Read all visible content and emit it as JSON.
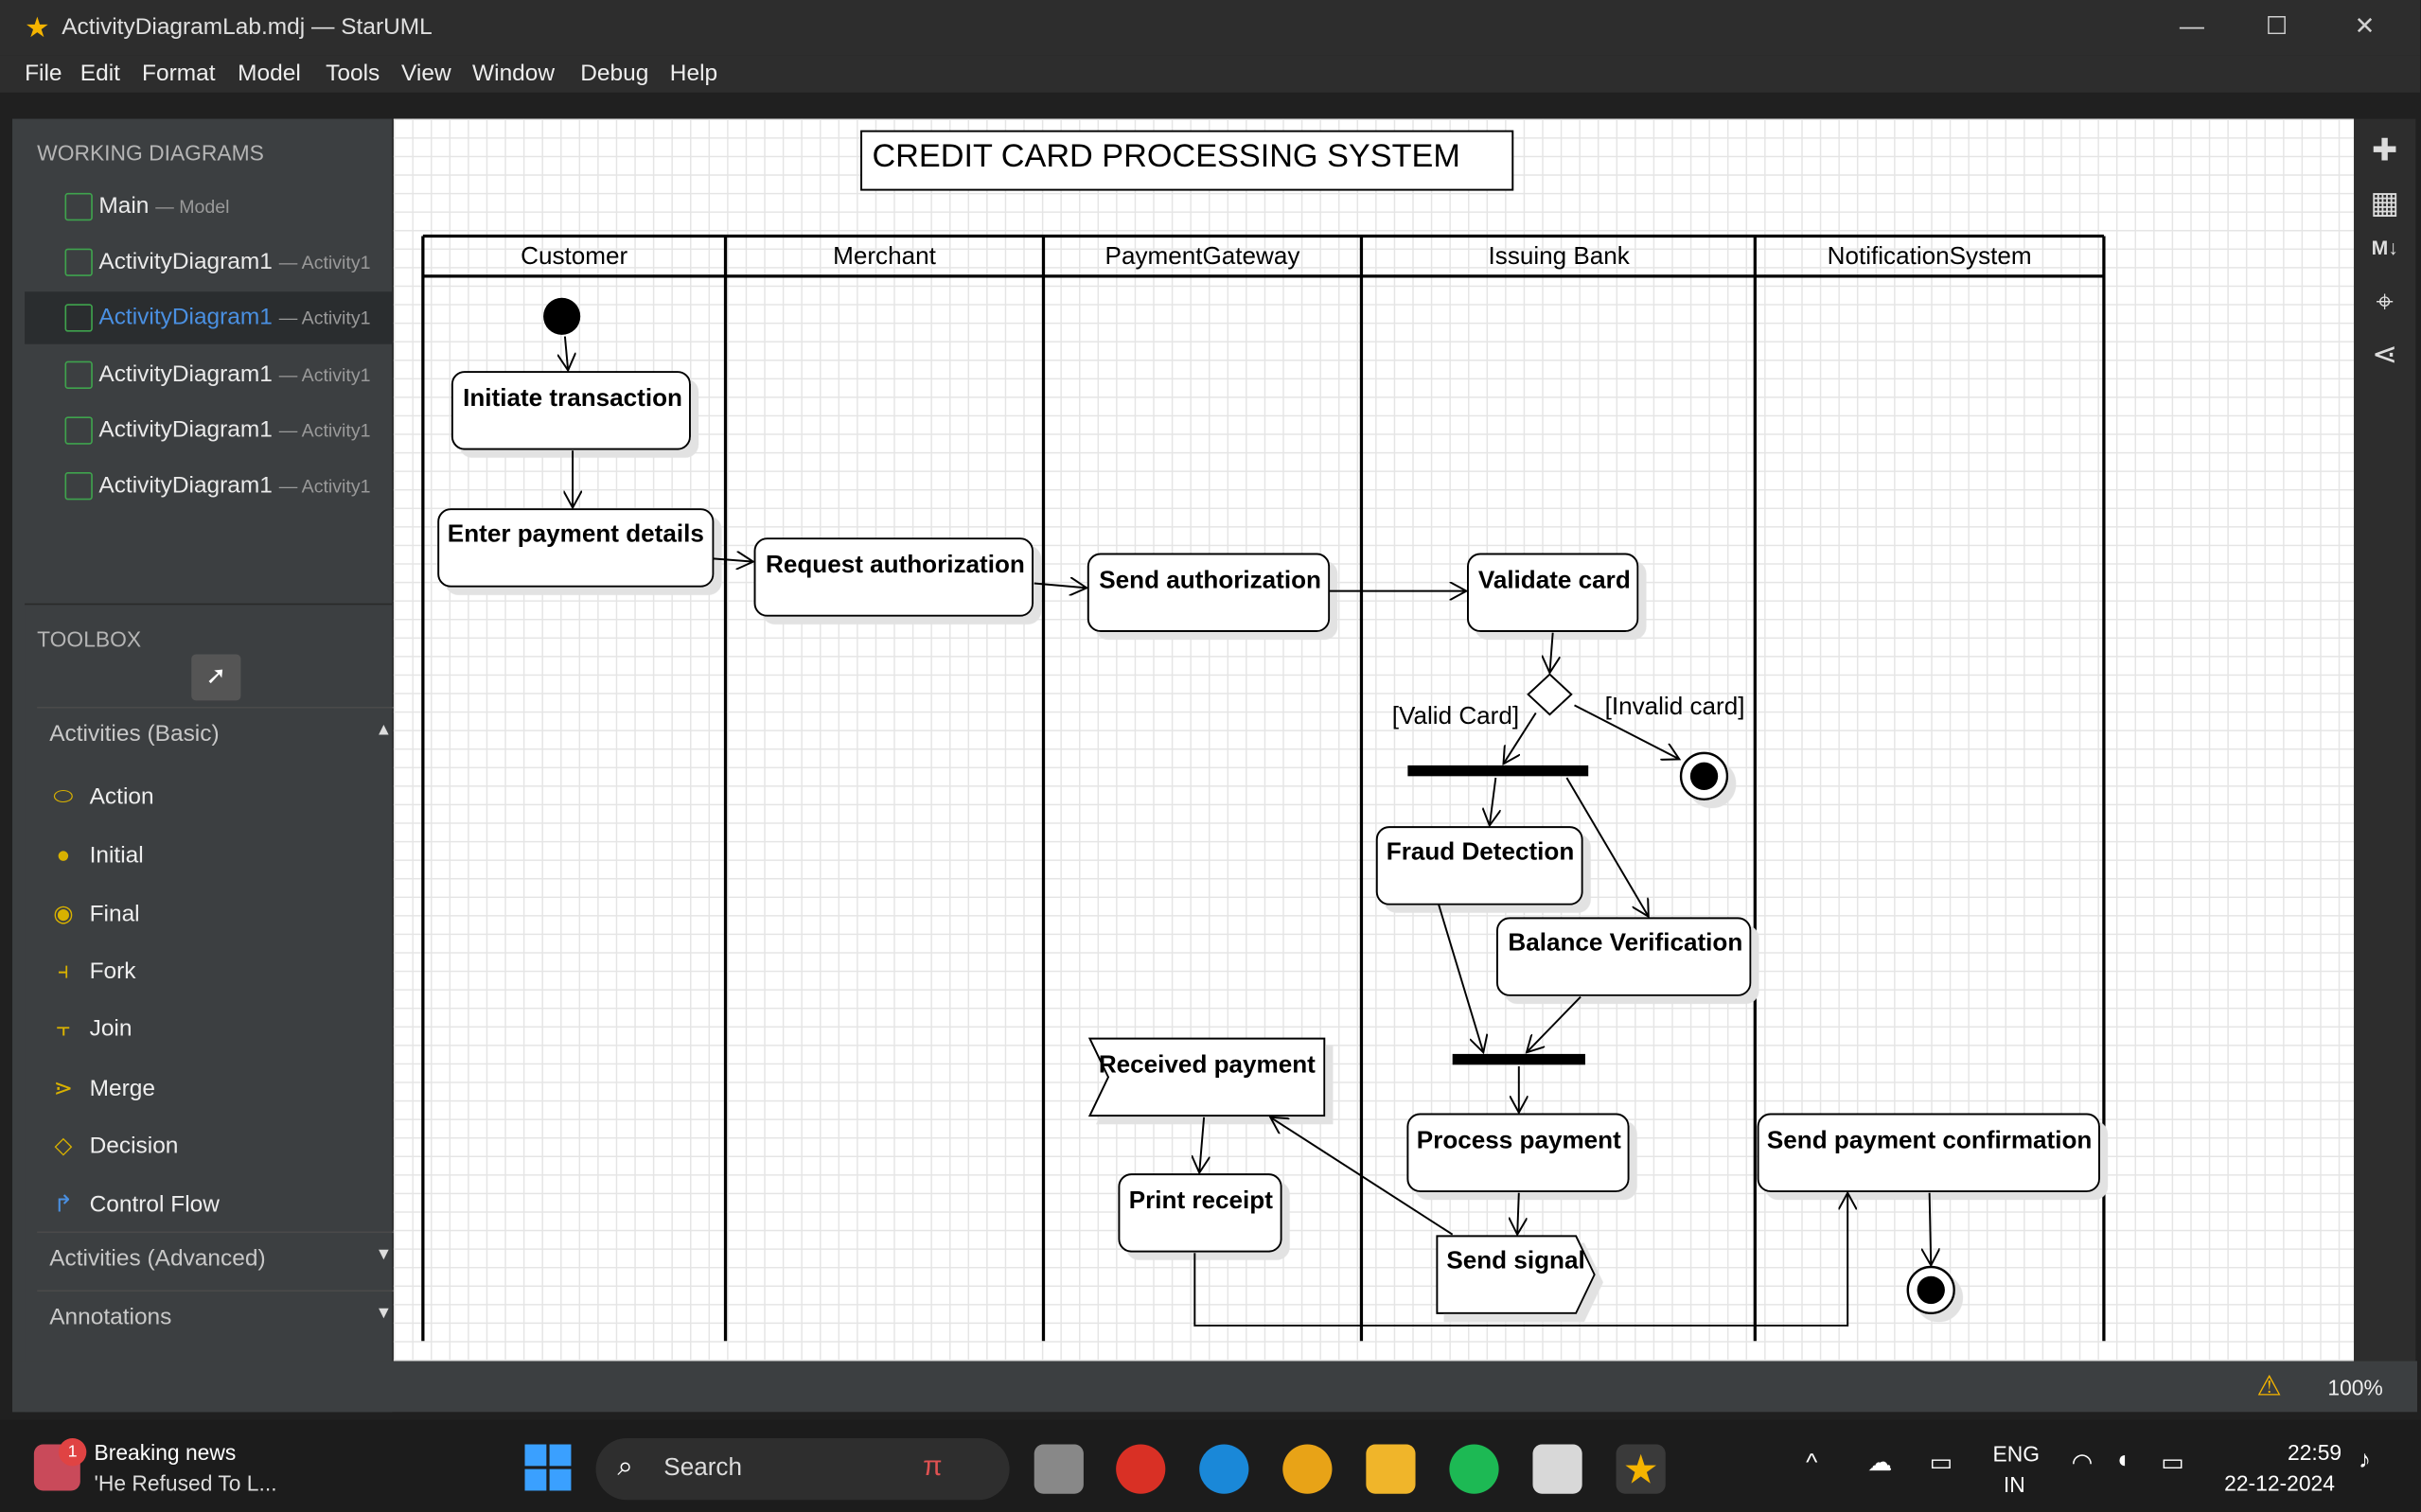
{
  "window": {
    "title": "ActivityDiagramLab.mdj — StarUML"
  },
  "menu": [
    "File",
    "Edit",
    "Format",
    "Model",
    "Tools",
    "View",
    "Window",
    "Debug",
    "Help"
  ],
  "working": {
    "heading": "WORKING DIAGRAMS",
    "items": [
      {
        "name": "Main",
        "sub": "— Model"
      },
      {
        "name": "ActivityDiagram1",
        "sub": "— Activity1"
      },
      {
        "name": "ActivityDiagram1",
        "sub": "— Activity1"
      },
      {
        "name": "ActivityDiagram1",
        "sub": "— Activity1"
      },
      {
        "name": "ActivityDiagram1",
        "sub": "— Activity1"
      },
      {
        "name": "ActivityDiagram1",
        "sub": "— Activity1"
      }
    ]
  },
  "toolbox": {
    "heading": "TOOLBOX",
    "group1": "Activities (Basic)",
    "tools": [
      "Action",
      "Initial",
      "Final",
      "Fork",
      "Join",
      "Merge",
      "Decision",
      "Control Flow"
    ],
    "group2": "Activities (Advanced)",
    "group3": "Annotations"
  },
  "diagram": {
    "title": "CREDIT CARD PROCESSING SYSTEM",
    "lanes": [
      "Customer",
      "Merchant",
      "PaymentGateway",
      "Issuing Bank",
      "NotificationSystem"
    ],
    "actions": {
      "initiate": "Initiate transaction",
      "enter": "Enter payment details",
      "request": "Request authorization",
      "send_auth": "Send authorization",
      "validate": "Validate card",
      "fraud": "Fraud Detection",
      "balance": "Balance Verification",
      "received": "Received payment",
      "print": "Print receipt",
      "process": "Process payment",
      "signal": "Send signal",
      "confirm": "Send payment confirmation"
    },
    "guards": {
      "valid": "[Valid Card]",
      "invalid": "[Invalid card]"
    }
  },
  "status": {
    "zoom": "100%"
  },
  "taskbar": {
    "news_title": "Breaking news",
    "news_sub": "'He Refused To L...",
    "news_badge": "1",
    "search": "Search",
    "lang1": "ENG",
    "lang2": "IN",
    "time": "22:59",
    "date": "22-12-2024"
  }
}
